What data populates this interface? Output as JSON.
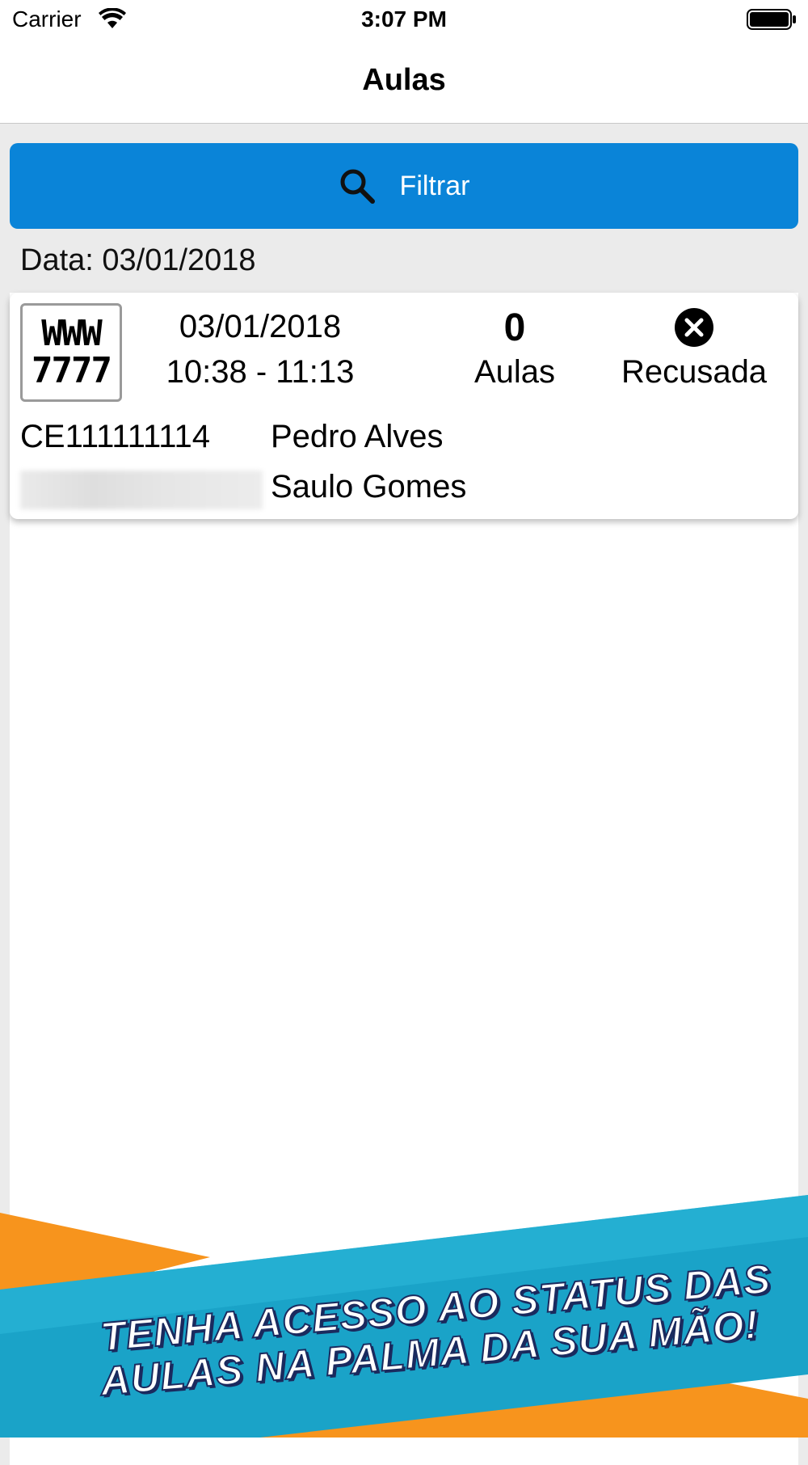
{
  "status_bar": {
    "carrier": "Carrier",
    "time": "3:07 PM",
    "wifi_icon": "wifi-icon",
    "battery_icon": "battery-icon"
  },
  "nav": {
    "title": "Aulas"
  },
  "filter": {
    "label": "Filtrar",
    "icon": "search-icon",
    "color": "#0a84d8"
  },
  "date_header": "Data: 03/01/2018",
  "lessons": [
    {
      "plate_line_1": "WWW",
      "plate_line_2": "7777",
      "date": "03/01/2018",
      "time": "10:38 - 11:13",
      "count": "0",
      "count_label": "Aulas",
      "status_icon": "close-circle-icon",
      "status": "Recusada",
      "code": "CE111111114",
      "student": "Pedro Alves",
      "instructor": "Saulo Gomes"
    }
  ],
  "promo": {
    "line_1": "TENHA ACESSO AO STATUS DAS",
    "line_2": "AULAS NA PALMA DA SUA MÃO!",
    "colors": {
      "teal": "#1aa3c8",
      "orange": "#f7941d",
      "outline": "#1a2a5e"
    }
  }
}
